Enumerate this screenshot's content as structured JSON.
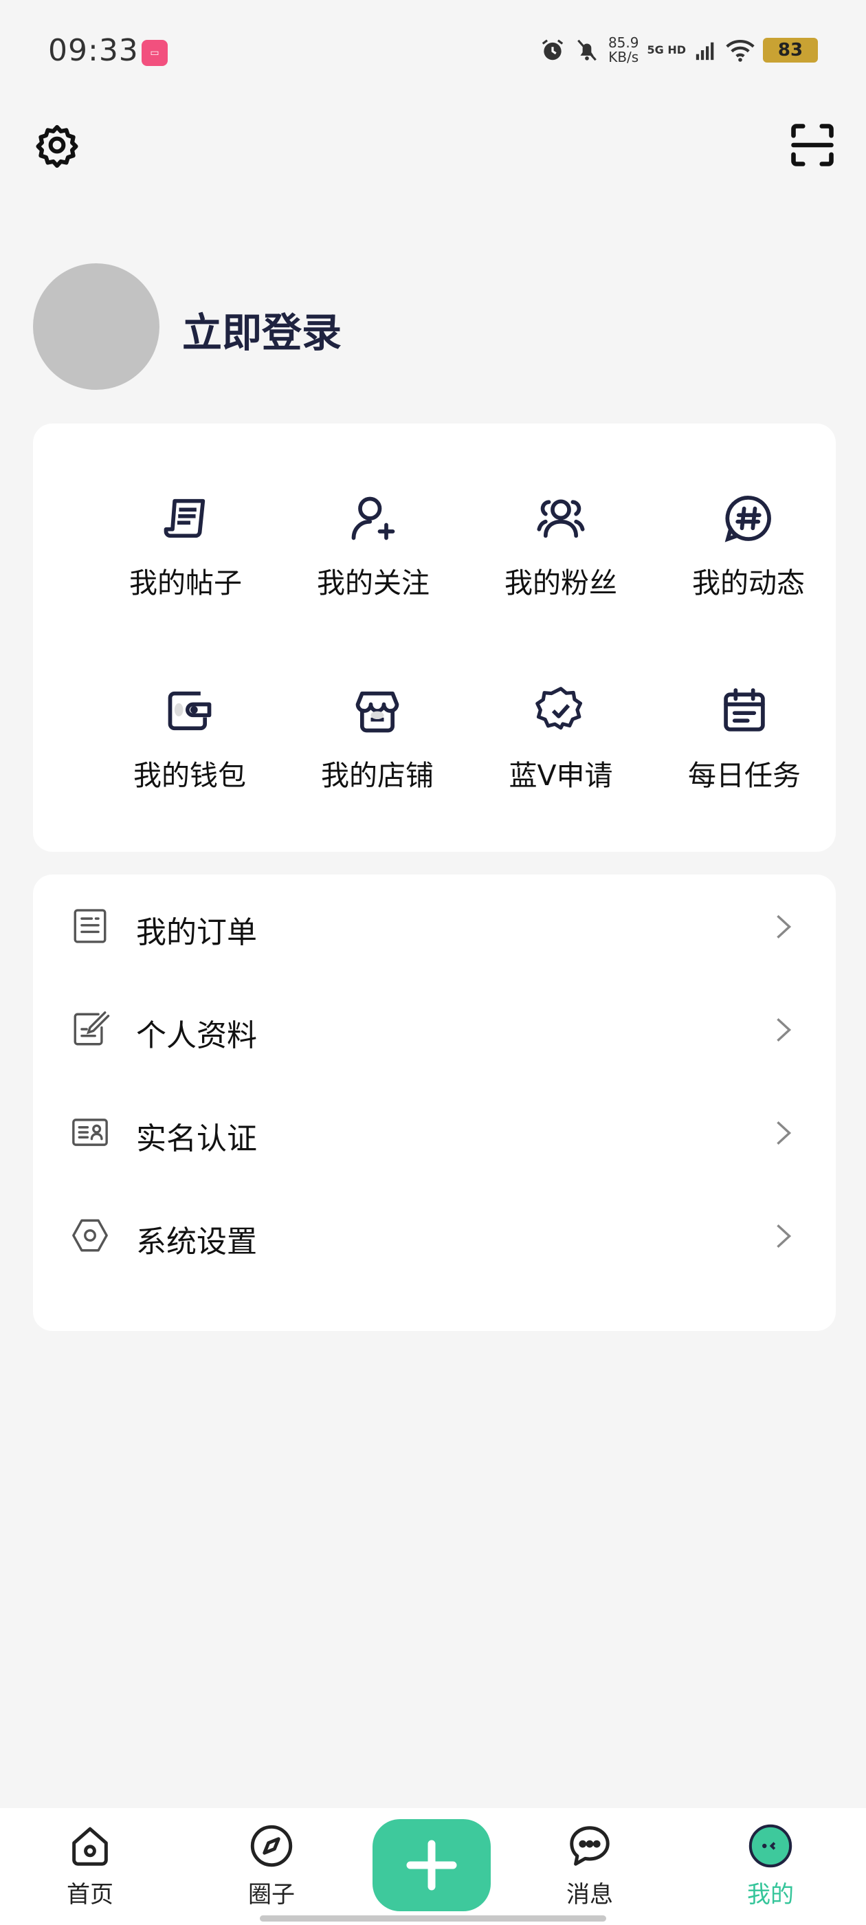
{
  "status_bar": {
    "time": "09:33",
    "app_badge": "taobao-like",
    "speed_value": "85.9",
    "speed_unit": "KB/s",
    "network": "5G HD",
    "battery": "83"
  },
  "profile": {
    "login_label": "立即登录"
  },
  "grid": {
    "items": [
      {
        "label": "我的帖子",
        "icon": "post-icon"
      },
      {
        "label": "我的关注",
        "icon": "follow-icon"
      },
      {
        "label": "我的粉丝",
        "icon": "fans-icon"
      },
      {
        "label": "我的动态",
        "icon": "hashtag-icon"
      },
      {
        "label": "我的钱包",
        "icon": "wallet-icon"
      },
      {
        "label": "我的店铺",
        "icon": "store-icon"
      },
      {
        "label": "蓝V申请",
        "icon": "verified-badge-icon"
      },
      {
        "label": "每日任务",
        "icon": "calendar-icon"
      }
    ]
  },
  "menu": {
    "items": [
      {
        "label": "我的订单",
        "icon": "order-icon"
      },
      {
        "label": "个人资料",
        "icon": "edit-profile-icon"
      },
      {
        "label": "实名认证",
        "icon": "id-card-icon"
      },
      {
        "label": "系统设置",
        "icon": "hexagon-settings-icon"
      }
    ]
  },
  "bottom_nav": {
    "items": [
      {
        "label": "首页",
        "icon": "home-icon"
      },
      {
        "label": "圈子",
        "icon": "compass-icon"
      },
      {
        "label": "消息",
        "icon": "chat-icon"
      },
      {
        "label": "我的",
        "icon": "profile-face-icon"
      }
    ],
    "active": "我的",
    "accent": "#3ec99c"
  },
  "colors": {
    "background": "#f5f5f5",
    "card": "#ffffff",
    "title": "#1f2340",
    "icon_dark": "#1f2340",
    "accent": "#3ec99c"
  }
}
